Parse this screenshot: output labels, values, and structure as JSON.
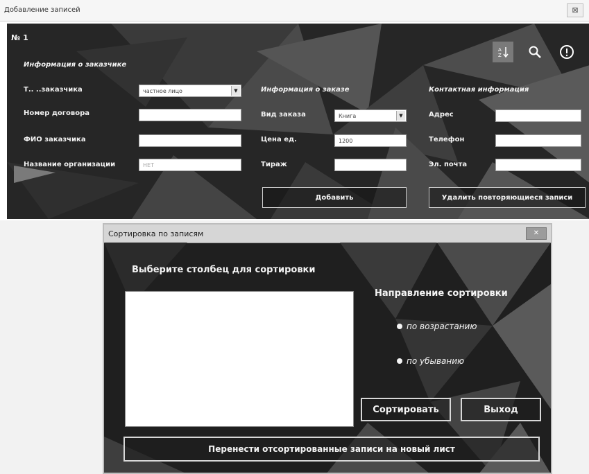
{
  "main_window": {
    "title": "Добавление записей",
    "close_glyph": "⊠",
    "record_number": "№ 1",
    "customer_section_title": "Информация о заказчике",
    "order_section_title": "Информация о заказе",
    "contact_section_title": "Контактная информация",
    "customer_type_label": "Т..  ..заказчика",
    "customer_type_value": "частное лицо",
    "contract_number_label": "Номер договора",
    "customer_name_label": "ФИО заказчика",
    "organization_label": "Название организации",
    "organization_value": "НЕТ",
    "order_type_label": "Вид заказа",
    "order_type_value": "Книга",
    "unit_price_label": "Цена ед.",
    "unit_price_value": "1200",
    "print_run_label": "Тираж",
    "address_label": "Адрес",
    "phone_label": "Телефон",
    "email_label": "Эл. почта",
    "add_button": "Добавить",
    "remove_duplicates_button": "Удалить повторяющиеся записи",
    "icons": [
      "sort-icon",
      "search-icon",
      "info-icon"
    ]
  },
  "sort_dialog": {
    "title": "Сортировка по записям",
    "close_glyph": "✕",
    "column_prompt": "Выберите столбец для сортировки",
    "direction_title": "Направление сортировки",
    "ascending_label": "по возрастанию",
    "descending_label": "по убыванию",
    "sort_button": "Сортировать",
    "exit_button": "Выход",
    "move_button": "Перенести отсортированные записи на новый лист"
  },
  "colors": {
    "panel_bg": "#262626",
    "sort_icon_bg": "#7a7a7a"
  }
}
